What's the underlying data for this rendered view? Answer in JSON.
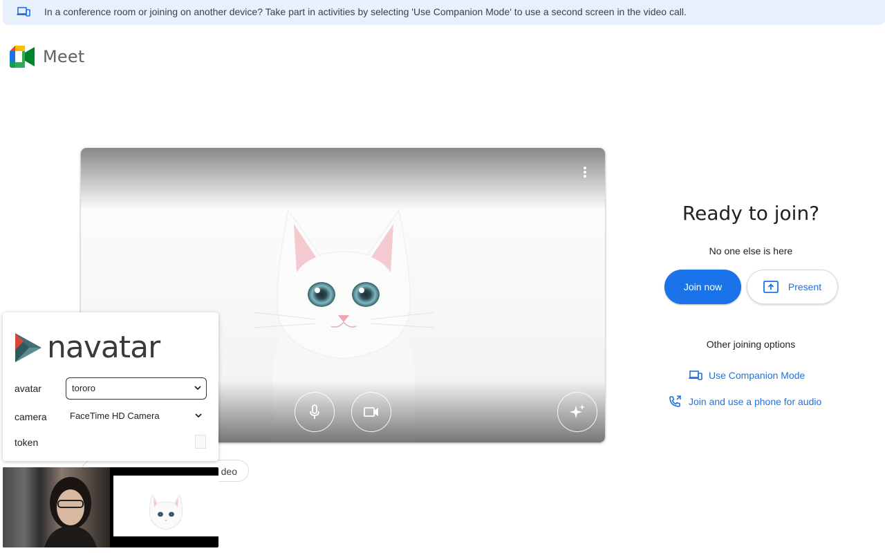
{
  "banner": {
    "text": "In a conference room or joining on another device? Take part in activities by selecting 'Use Companion Mode' to use a second screen in the video call."
  },
  "app": {
    "name": "Meet"
  },
  "preview": {
    "icons": [
      "more-vert-icon",
      "mic-icon",
      "videocam-icon",
      "sparkle-effects-icon"
    ]
  },
  "join_panel": {
    "title": "Ready to join?",
    "status": "No one else is here",
    "join_label": "Join now",
    "present_label": "Present",
    "other_options": "Other joining options",
    "companion_label": "Use Companion Mode",
    "phone_label": "Join and use a phone for audio"
  },
  "chip": {
    "text": "deo"
  },
  "navatar": {
    "logo_text": "navatar",
    "avatar_label": "avatar",
    "avatar_value": "tororo",
    "camera_label": "camera",
    "camera_value": "FaceTime HD Camera",
    "token_label": "token"
  },
  "colors": {
    "accent": "#1a73e8",
    "banner_bg": "#e8f0fe"
  }
}
